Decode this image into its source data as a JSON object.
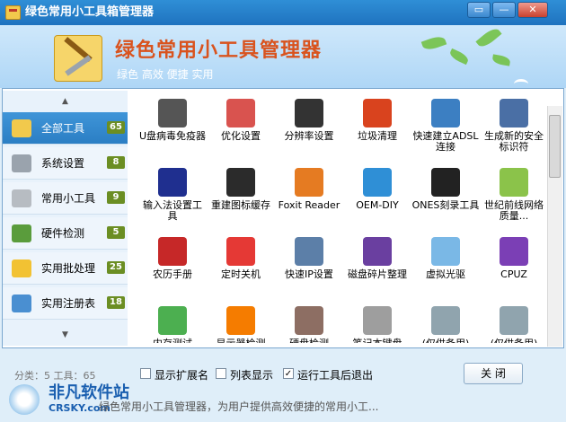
{
  "window": {
    "title": "绿色常用小工具箱管理器",
    "btn_min": "—",
    "btn_close": "✕",
    "btn_chat": "▭"
  },
  "banner": {
    "title": "绿色常用小工具管理器",
    "subtitle": "绿色 高效 便捷 实用"
  },
  "sidebar": {
    "up_arrow": "▲",
    "down_arrow": "▼",
    "items": [
      {
        "label": "全部工具",
        "count": "65",
        "icon": "toolbox-icon",
        "color": "#f2c94c"
      },
      {
        "label": "系统设置",
        "count": "8",
        "icon": "gears-icon",
        "color": "#9aa3ad"
      },
      {
        "label": "常用小工具",
        "count": "9",
        "icon": "wrench-icon",
        "color": "#b7bcc2"
      },
      {
        "label": "硬件检测",
        "count": "5",
        "icon": "chip-icon",
        "color": "#5a9c3c"
      },
      {
        "label": "实用批处理",
        "count": "25",
        "icon": "star-icon",
        "color": "#f2c233"
      },
      {
        "label": "实用注册表",
        "count": "18",
        "icon": "feather-icon",
        "color": "#4a8fd1"
      }
    ]
  },
  "tools": [
    {
      "label": "U盘病毒免疫器",
      "icon": "syringe-icon",
      "color": "#555555"
    },
    {
      "label": "优化设置",
      "icon": "shield-icon",
      "color": "#d9534f"
    },
    {
      "label": "分辨率设置",
      "icon": "monitor-icon",
      "color": "#333333"
    },
    {
      "label": "垃圾清理",
      "icon": "ccleaner-icon",
      "color": "#d9431e"
    },
    {
      "label": "快速建立ADSL连接",
      "icon": "network-icon",
      "color": "#3c7fc2"
    },
    {
      "label": "生成新的安全标识符",
      "icon": "computer-icon",
      "color": "#4a6fa5"
    },
    {
      "label": "输入法设置工具",
      "icon": "question-icon",
      "color": "#1f2f8f"
    },
    {
      "label": "重建图标缓存",
      "icon": "p-icon",
      "color": "#2b2b2b"
    },
    {
      "label": "Foxit Reader",
      "icon": "foxit-icon",
      "color": "#e57b22"
    },
    {
      "label": "OEM-DIY",
      "icon": "globe-icon",
      "color": "#2f8fd6"
    },
    {
      "label": "ONES刻录工具",
      "icon": "ones-icon",
      "color": "#222222"
    },
    {
      "label": "世纪前线网络质量...",
      "icon": "flower-icon",
      "color": "#8bc34a"
    },
    {
      "label": "农历手册",
      "icon": "calendar-icon",
      "color": "#c62828"
    },
    {
      "label": "定时关机",
      "icon": "power-icon",
      "color": "#e53935"
    },
    {
      "label": "快速IP设置",
      "icon": "ip-icon",
      "color": "#5c7fa8"
    },
    {
      "label": "磁盘碎片整理",
      "icon": "defrag-icon",
      "color": "#6a3fa0"
    },
    {
      "label": "虚拟光驱",
      "icon": "disc-icon",
      "color": "#7ab8e6"
    },
    {
      "label": "CPUZ",
      "icon": "cpuz-icon",
      "color": "#7b3fb5"
    },
    {
      "label": "内存测试",
      "icon": "check-icon",
      "color": "#4caf50"
    },
    {
      "label": "显示器检测",
      "icon": "display-icon",
      "color": "#f57c00"
    },
    {
      "label": "硬盘检测",
      "icon": "hdd-icon",
      "color": "#8d6e63"
    },
    {
      "label": "笔记本键盘",
      "icon": "keyboard-icon",
      "color": "#9e9e9e"
    },
    {
      "label": "(仅供备用)",
      "icon": "setting-icon",
      "color": "#90a4ae"
    },
    {
      "label": "(仅供备用)",
      "icon": "setting-icon",
      "color": "#90a4ae"
    }
  ],
  "footer": {
    "status": "分类：5  工具：65",
    "checkboxes": [
      {
        "label": "显示扩展名",
        "checked": false
      },
      {
        "label": "列表显示",
        "checked": false
      },
      {
        "label": "运行工具后退出",
        "checked": true
      }
    ],
    "close_button": "关 闭",
    "marquee": "绿色常用小工具管理器，为用户提供高效便捷的常用小工...",
    "watermark_title": "非凡软件站",
    "watermark_sub": "CRSKY.com"
  }
}
